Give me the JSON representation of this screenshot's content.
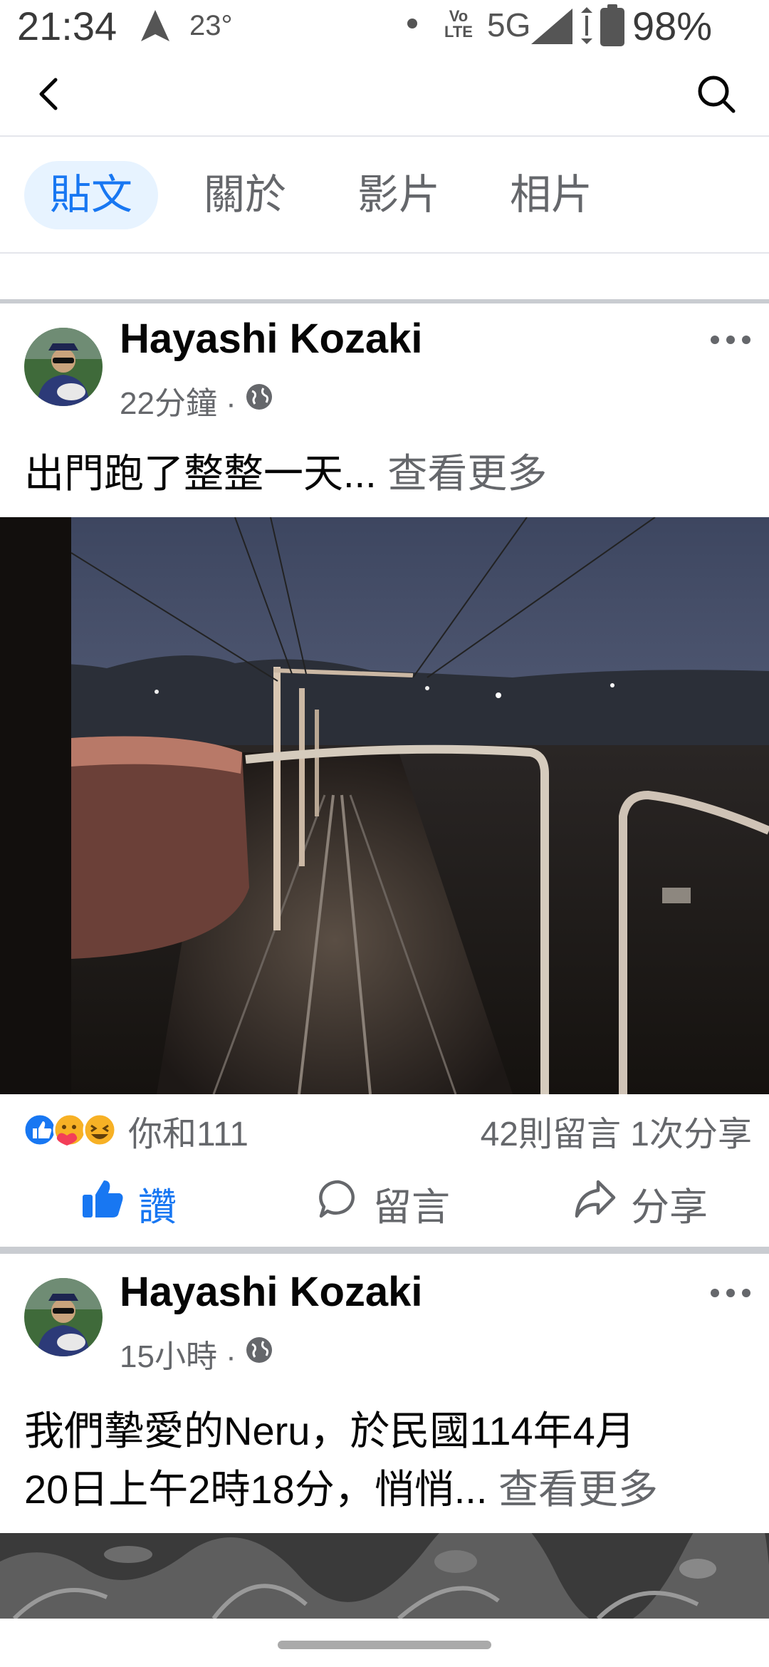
{
  "status_bar": {
    "time": "21:34",
    "temperature": "23°",
    "volte": "Vo LTE",
    "network": "5G",
    "battery": "98%"
  },
  "icons": {
    "back": "back-arrow-icon",
    "search": "search-icon",
    "more": "more-dots-icon",
    "globe": "globe-icon",
    "like": "thumbs-up-icon",
    "comment": "comment-icon",
    "share": "share-icon"
  },
  "tabs": [
    {
      "label": "貼文",
      "active": true
    },
    {
      "label": "關於",
      "active": false
    },
    {
      "label": "影片",
      "active": false
    },
    {
      "label": "相片",
      "active": false
    }
  ],
  "posts": [
    {
      "author": "Hayashi Kozaki",
      "time": "22分鐘 ·",
      "text": "出門跑了整整一天...",
      "see_more": "查看更多",
      "reactions_text": "你和111",
      "counts": "42則留言  1次分享"
    },
    {
      "author": "Hayashi Kozaki",
      "time": "15小時 ·",
      "text_line1": "我們摯愛的Neru，於民國114年4月",
      "text_line2": "20日上午2時18分，悄悄...",
      "see_more": "查看更多"
    }
  ],
  "actions": {
    "like": "讚",
    "comment": "留言",
    "share": "分享"
  },
  "colors": {
    "accent": "#1877f2",
    "secondary_text": "#65676b",
    "tab_active_bg": "#e7f3ff",
    "divider": "#c9ccd1"
  }
}
